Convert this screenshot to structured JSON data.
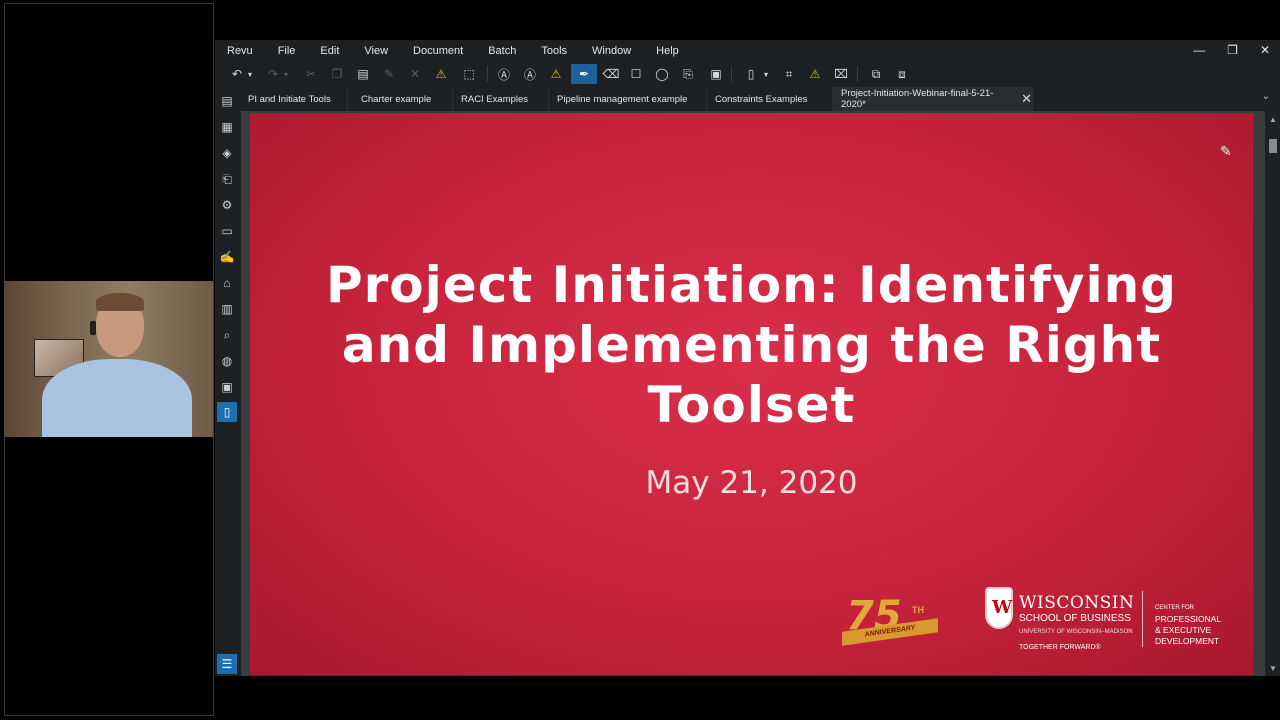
{
  "window": {
    "menu": [
      "Revu",
      "File",
      "Edit",
      "View",
      "Document",
      "Batch",
      "Tools",
      "Window",
      "Help"
    ],
    "controls": {
      "minimize": "—",
      "restore": "❐",
      "close": "✕"
    }
  },
  "tabs": [
    {
      "label": "PI and Initiate Tools",
      "active": false
    },
    {
      "label": "Charter example",
      "active": false
    },
    {
      "label": "RACI Examples",
      "active": false
    },
    {
      "label": "Pipeline management example",
      "active": false
    },
    {
      "label": "Constraints Examples",
      "active": false
    },
    {
      "label": "Project-Initiation-Webinar-final-5-21-2020*",
      "active": true
    }
  ],
  "slide": {
    "title": "Project Initiation: Identifying and Implementing the Right Toolset",
    "date": "May 21, 2020",
    "anniversary": {
      "number": "75",
      "suffix": "TH",
      "ribbon": "ANNIVERSARY"
    },
    "logo": {
      "crest_letter": "W",
      "name": "WISCONSIN",
      "school": "SCHOOL OF BUSINESS",
      "university": "UNIVERSITY OF WISCONSIN–MADISON",
      "tagline": "TOGETHER FORWARD®",
      "center_line1": "CENTER FOR",
      "center_line2": "PROFESSIONAL",
      "center_line3": "& EXECUTIVE",
      "center_line4": "DEVELOPMENT"
    }
  },
  "colors": {
    "slide_red": "#c7233c",
    "app_bg": "#1e2124",
    "accent_blue": "#1f6fb0",
    "gold": "#e0a93a"
  }
}
